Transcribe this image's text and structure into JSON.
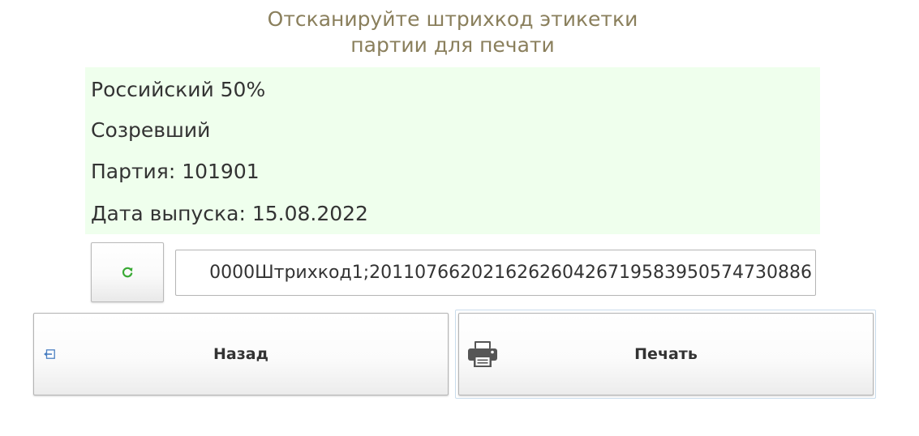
{
  "header": {
    "instruction_line1": "Отсканируйте штрихкод этикетки",
    "instruction_line2": "партии для печати"
  },
  "info": {
    "product_name": "Российский 50%",
    "product_state": "Созревший",
    "batch": "Партия: 101901",
    "release_date": "Дата выпуска: 15.08.2022"
  },
  "scan": {
    "barcode_value": "0000Штрихкод1;201107662021626260426719583950574730886"
  },
  "buttons": {
    "back_label": "Назад",
    "print_label": "Печать"
  },
  "icons": {
    "refresh": "refresh-icon",
    "back": "back-arrow-icon",
    "print": "printer-icon"
  },
  "colors": {
    "instruction_text": "#8a7f5c",
    "info_panel_bg": "#efffed",
    "refresh_icon": "#3aaa35",
    "back_icon": "#4a7fc1",
    "print_icon": "#555555"
  }
}
